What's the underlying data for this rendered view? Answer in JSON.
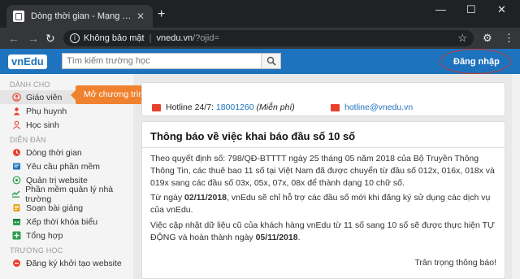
{
  "browser": {
    "tab_title": "Dòng thời gian - Mạng giáo dục",
    "new_tab": "+",
    "security": "Không bảo mật",
    "domain": "vnedu.vn",
    "path": "/?ojid="
  },
  "header": {
    "logo_main": "vnEdu",
    "search_placeholder": "Tìm kiếm trường học",
    "login_label": "Đăng nhập"
  },
  "sidebar": {
    "section1": "DÀNH CHO",
    "section1_items": [
      {
        "label": "Giáo viên",
        "icon": "user-icon"
      },
      {
        "label": "Phụ huynh",
        "icon": "user-icon"
      },
      {
        "label": "Học sinh",
        "icon": "user-icon"
      }
    ],
    "section2": "DIỄN ĐÀN",
    "section2_items": [
      {
        "label": "Dòng thời gian",
        "icon": "timeline-icon"
      },
      {
        "label": "Yêu cầu phần mềm",
        "icon": "request-icon"
      },
      {
        "label": "Quản trị website",
        "icon": "web-icon"
      },
      {
        "label": "Phần mềm quản lý nhà trường",
        "icon": "software-icon"
      },
      {
        "label": "Soạn bài giảng",
        "icon": "lesson-icon"
      },
      {
        "label": "Xếp thời khóa biểu",
        "icon": "schedule-icon"
      },
      {
        "label": "Tổng hợp",
        "icon": "plus-icon"
      }
    ],
    "section3": "TRƯỜNG HỌC",
    "section3_items": [
      {
        "label": "Đăng ký khởi tạo website",
        "icon": "register-icon"
      }
    ]
  },
  "tooltip": {
    "text": "Mở chương trình quản lý trường học",
    "close": "✖"
  },
  "hotline": {
    "label": "Hotline 24/7:",
    "number": "18001260",
    "note": "(Miễn phí)",
    "email": "hotline@vnedu.vn"
  },
  "notice": {
    "title": "Thông báo về việc khai báo đầu số 10 số",
    "para1": "Theo quyết định số: 798/QĐ-BTTTT ngày 25 tháng 05 năm 2018 của Bộ Truyền Thông Thông Tin, các thuê bao 11 số tại Việt Nam đã được chuyển từ đầu số 012x, 016x, 018x và 019x sang các đầu số 03x, 05x, 07x, 08x để thành dạng 10 chữ số.",
    "para2_pre": "Từ ngày ",
    "para2_date": "02/11/2018",
    "para2_post": ", vnEdu sẽ chỉ hỗ trợ các đầu số mới khi đăng ký sử dụng các dịch vụ của vnEdu.",
    "para3_pre": "Việc cập nhật dữ liệu cũ của khách hàng vnEdu từ 11 số sang 10 số sẽ được thực hiện TỰ ĐỘNG và hoàn thành ngày ",
    "para3_date": "05/11/2018",
    "para3_post": ".",
    "sign": "Trân trọng thông báo!"
  },
  "colors": {
    "brand_blue": "#1e73be",
    "tooltip_orange": "#f0822f",
    "highlight_red": "#c0392b"
  }
}
